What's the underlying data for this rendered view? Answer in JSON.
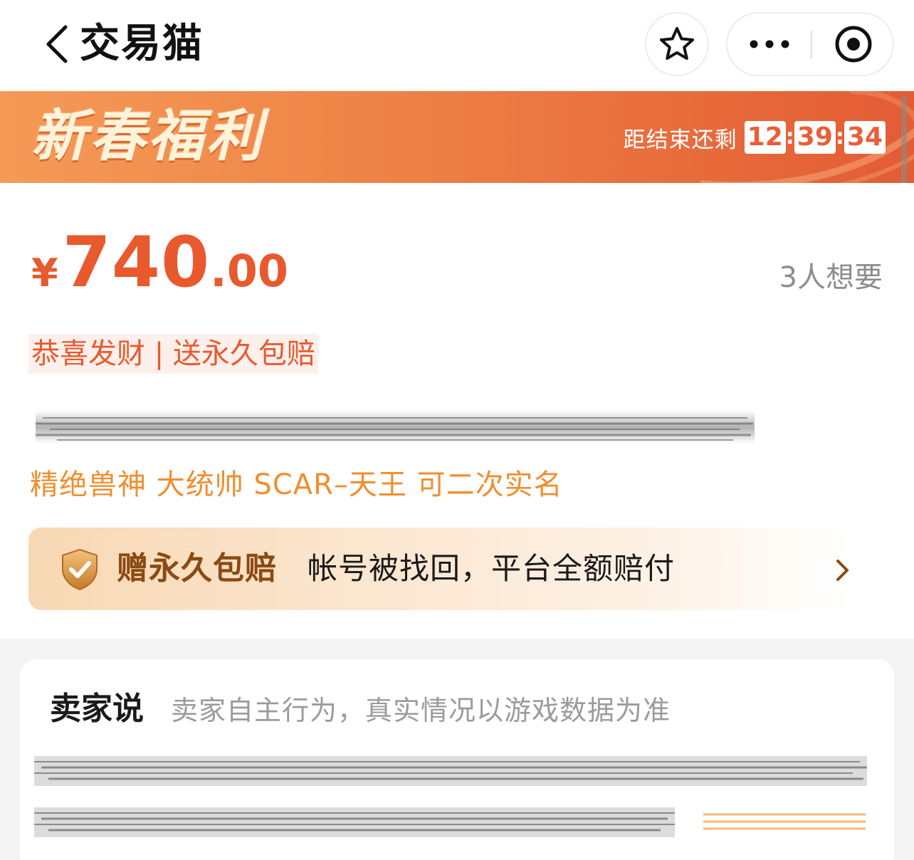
{
  "header": {
    "title": "交易猫"
  },
  "banner": {
    "title": "新春福利",
    "countdown_label": "距结束还剩",
    "hours": "12",
    "minutes": "39",
    "seconds": "34",
    "separator": ":"
  },
  "listing": {
    "currency": "¥",
    "price_int": "740",
    "price_dec": ".00",
    "wants": "3人想要",
    "tag": "恭喜发财 | 送永久包赔",
    "subtitle": "精绝兽神 大统帅 SCAR–天王 可二次实名"
  },
  "guarantee": {
    "title": "赠永久包赔",
    "description": "帐号被找回，平台全额赔付"
  },
  "seller": {
    "title": "卖家说",
    "note": "卖家自主行为，真实情况以游戏数据为准"
  },
  "colors": {
    "accent": "#e85a2d",
    "orange_text": "#f08e2e",
    "banner_start": "#f59a56",
    "banner_end": "#e35c34",
    "guarantee_text": "#8b4a12"
  }
}
